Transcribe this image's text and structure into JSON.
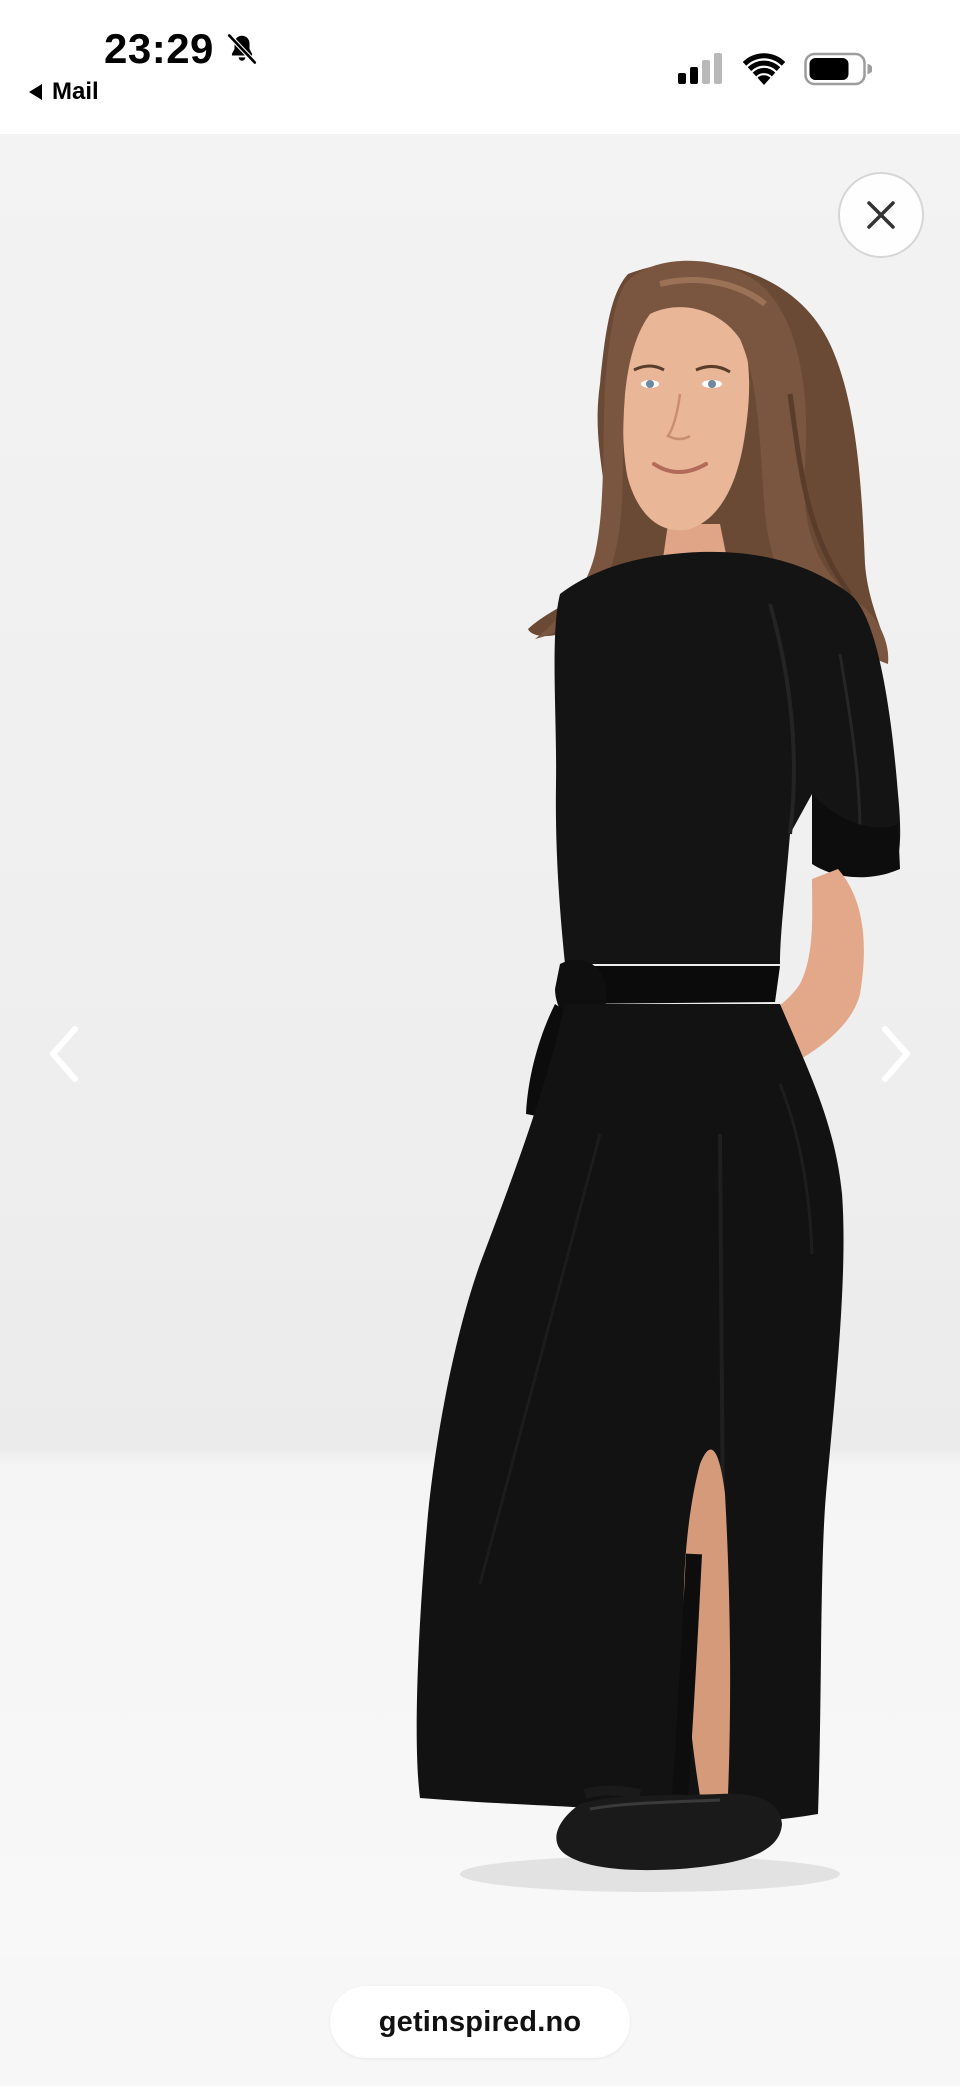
{
  "status_bar": {
    "time": "23:29",
    "silent_icon": "bell-slash-icon",
    "back_label": "Mail",
    "back_icon": "back-triangle-icon",
    "signal_icon": "cellular-signal-icon",
    "wifi_icon": "wifi-icon",
    "battery_icon": "battery-icon"
  },
  "viewer": {
    "image_alt": "",
    "close_icon": "close-icon",
    "prev_icon": "chevron-left-icon",
    "next_icon": "chevron-right-icon"
  },
  "browser": {
    "url": "getinspired.no"
  },
  "colors": {
    "background": "#ffffff",
    "photo_backdrop": "#f1f1f1",
    "dress": "#111111",
    "hair": "#6b4a35",
    "skin": "#e7b394",
    "text": "#000000"
  }
}
